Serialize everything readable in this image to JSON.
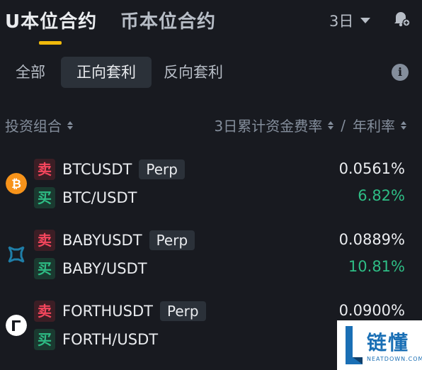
{
  "header": {
    "tab_active": "U本位合约",
    "tab_inactive": "币本位合约",
    "period": "3日"
  },
  "filters": {
    "all": "全部",
    "positive": "正向套利",
    "reverse": "反向套利"
  },
  "columns": {
    "left": "投资组合",
    "right_a": "3日累计资金费率",
    "separator": "/",
    "right_b": "年利率"
  },
  "labels": {
    "sell": "卖",
    "buy": "买",
    "perp": "Perp"
  },
  "rows": [
    {
      "coin_icon": "btc-icon",
      "perp_symbol": "BTCUSDT",
      "spot_symbol": "BTC/USDT",
      "funding_rate": "0.0561%",
      "apr": "6.82%"
    },
    {
      "coin_icon": "baby-icon",
      "perp_symbol": "BABYUSDT",
      "spot_symbol": "BABY/USDT",
      "funding_rate": "0.0889%",
      "apr": "10.81%"
    },
    {
      "coin_icon": "forth-icon",
      "perp_symbol": "FORTHUSDT",
      "spot_symbol": "FORTH/USDT",
      "funding_rate": "0.0900%",
      "apr": ""
    }
  ],
  "watermark": {
    "title": "链懂",
    "subtitle": "NEATDOWN.COM"
  },
  "colors": {
    "accent": "#f0b90b",
    "sell": "#f6465d",
    "buy": "#2ebd85",
    "background": "#181a20"
  }
}
